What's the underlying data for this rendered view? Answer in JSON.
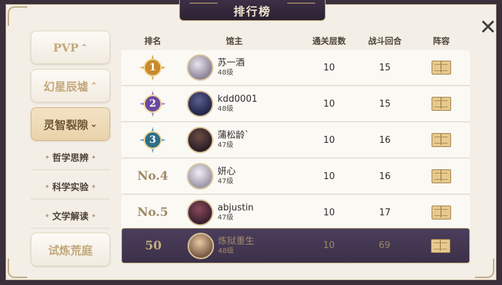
{
  "title": "排行榜",
  "close_icon": "close-icon",
  "sidebar": {
    "cards": [
      {
        "label": "PVP",
        "active": false
      },
      {
        "label": "幻星辰墟",
        "active": false
      },
      {
        "label": "灵智裂隙",
        "active": true
      }
    ],
    "subs": [
      "哲学思辨",
      "科学实验",
      "文学解读"
    ],
    "bottom_card": {
      "label": "试炼荒庭"
    }
  },
  "table": {
    "headers": {
      "rank": "排名",
      "lord": "馆主",
      "floors": "通关层数",
      "rounds": "战斗回合",
      "team": "阵容"
    },
    "rows": [
      {
        "rank": "1",
        "rank_style": "gold",
        "name": "苏一酒",
        "level": "48级",
        "floors": "10",
        "rounds": "15"
      },
      {
        "rank": "2",
        "rank_style": "purple",
        "name": "kdd0001",
        "level": "48级",
        "floors": "10",
        "rounds": "15"
      },
      {
        "rank": "3",
        "rank_style": "teal",
        "name": "蒲松龄`",
        "level": "47级",
        "floors": "10",
        "rounds": "16"
      },
      {
        "rank": "No.4",
        "rank_style": "text",
        "name": "妍心",
        "level": "47级",
        "floors": "10",
        "rounds": "16"
      },
      {
        "rank": "No.5",
        "rank_style": "text",
        "name": "abjustin",
        "level": "47级",
        "floors": "10",
        "rounds": "17"
      }
    ],
    "self_row": {
      "rank": "50",
      "name": "炼狱重生",
      "level": "48级",
      "floors": "10",
      "rounds": "69"
    }
  },
  "colors": {
    "gold": "#c98a2a",
    "purple": "#6a4a9c",
    "teal": "#2f6f86",
    "panel": "#f3eee6",
    "self_row": "#43364f"
  }
}
